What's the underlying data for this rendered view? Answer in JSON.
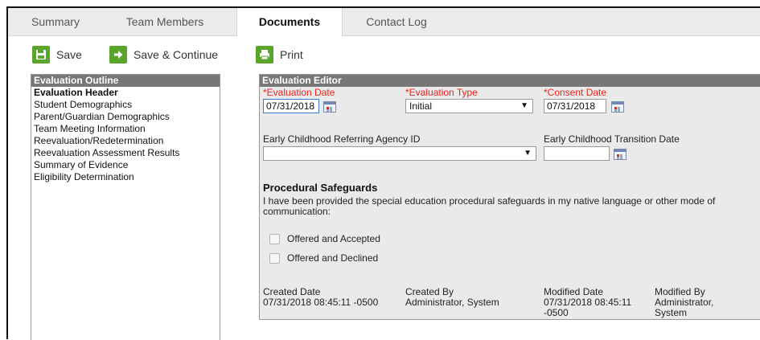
{
  "tabs": [
    {
      "label": "Summary"
    },
    {
      "label": "Team Members"
    },
    {
      "label": "Documents"
    },
    {
      "label": "Contact Log"
    }
  ],
  "toolbar": {
    "save_label": "Save",
    "save_continue_label": "Save & Continue",
    "print_label": "Print"
  },
  "outline": {
    "title": "Evaluation Outline",
    "items": [
      {
        "label": "Evaluation Header"
      },
      {
        "label": "Student Demographics"
      },
      {
        "label": "Parent/Guardian Demographics"
      },
      {
        "label": "Team Meeting Information"
      },
      {
        "label": "Reevaluation/Redetermination"
      },
      {
        "label": "Reevaluation Assessment Results"
      },
      {
        "label": "Summary of Evidence"
      },
      {
        "label": "Eligibility Determination"
      }
    ]
  },
  "editor": {
    "title": "Evaluation Editor",
    "evaluation_date": {
      "label": "*Evaluation Date",
      "value": "07/31/2018"
    },
    "evaluation_type": {
      "label": "*Evaluation Type",
      "value": "Initial"
    },
    "consent_date": {
      "label": "*Consent Date",
      "value": "07/31/2018"
    },
    "referring_agency": {
      "label": "Early Childhood Referring Agency ID",
      "value": ""
    },
    "transition_date": {
      "label": "Early Childhood Transition Date",
      "value": ""
    },
    "safeguards": {
      "heading": "Procedural Safeguards",
      "description": "I have been provided the special education procedural safeguards in my native language or other mode of communication:",
      "option_accepted": "Offered and Accepted",
      "option_declined": "Offered and Declined"
    },
    "meta": {
      "created_date_label": "Created Date",
      "created_date_value": "07/31/2018 08:45:11 -0500",
      "created_by_label": "Created By",
      "created_by_value": "Administrator, System",
      "modified_date_label": "Modified Date",
      "modified_date_value": "07/31/2018 08:45:11 -0500",
      "modified_by_label": "Modified By",
      "modified_by_value": "Administrator, System"
    }
  },
  "colors": {
    "accent_green": "#5aa52b",
    "required_red": "#e8241d",
    "panel_header": "#777777"
  },
  "icons": {
    "save": "floppy-disk-icon",
    "save_continue": "arrow-right-icon",
    "print": "printer-icon",
    "calendar": "calendar-icon",
    "dropdown": "chevron-down-icon"
  }
}
